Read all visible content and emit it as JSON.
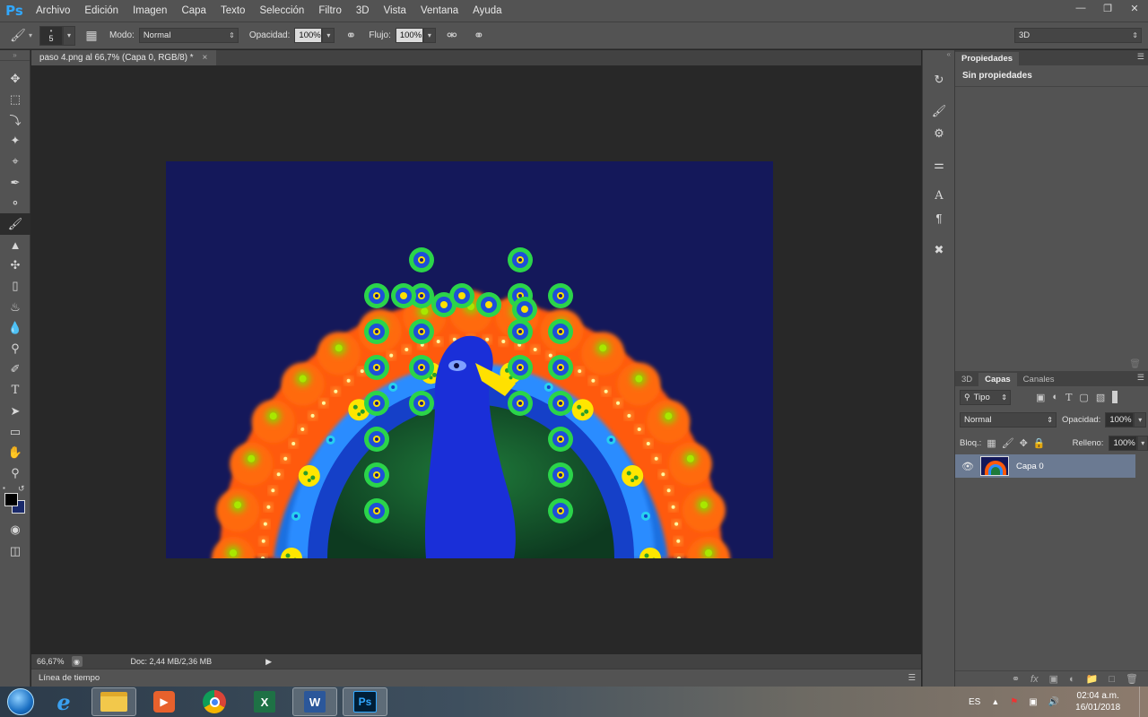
{
  "app": {
    "logo": "Ps",
    "menu": [
      "Archivo",
      "Edición",
      "Imagen",
      "Capa",
      "Texto",
      "Selección",
      "Filtro",
      "3D",
      "Vista",
      "Ventana",
      "Ayuda"
    ]
  },
  "options": {
    "brush_size": "5",
    "mode_label": "Modo:",
    "mode_value": "Normal",
    "opacity_label": "Opacidad:",
    "opacity_value": "100%",
    "flow_label": "Flujo:",
    "flow_value": "100%",
    "workspace": "3D"
  },
  "document": {
    "tab_title": "paso 4.png al 66,7% (Capa 0, RGB/8) *",
    "zoom": "66,67%",
    "doc_size": "Doc: 2,44 MB/2,36 MB",
    "timeline_label": "Línea de tiempo"
  },
  "properties_panel": {
    "tab": "Propiedades",
    "message": "Sin propiedades"
  },
  "layers_panel": {
    "tabs": [
      "3D",
      "Capas",
      "Canales"
    ],
    "filter_label": "Tipo",
    "blend_mode": "Normal",
    "opacity_label": "Opacidad:",
    "opacity_value": "100%",
    "lock_label": "Bloq.:",
    "fill_label": "Relleno:",
    "fill_value": "100%",
    "layers": [
      {
        "name": "Capa 0"
      }
    ]
  },
  "taskbar": {
    "language": "ES",
    "time": "02:04 a.m.",
    "date": "16/01/2018"
  },
  "colors": {
    "foreground": "#000000",
    "background": "#1a2a6b",
    "canvas_bg": "#14185a",
    "selected_layer": "#6b7a92"
  }
}
